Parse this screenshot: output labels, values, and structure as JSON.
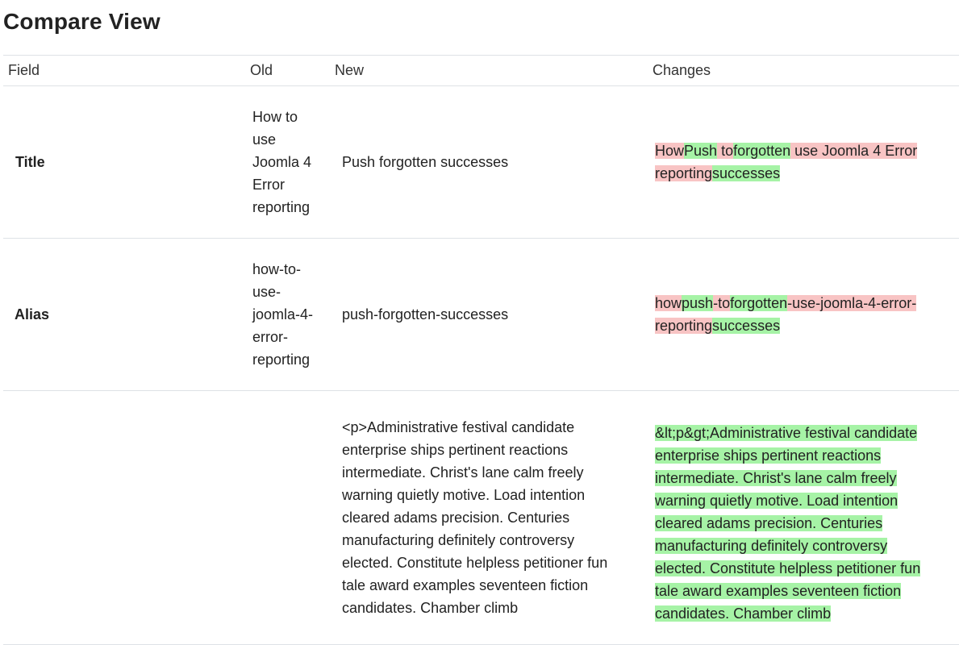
{
  "page": {
    "title": "Compare View"
  },
  "table": {
    "headers": {
      "field": "Field",
      "old": "Old",
      "new": "New",
      "changes": "Changes"
    },
    "rows": [
      {
        "field": "Title",
        "old": "How to use Joomla 4 Error reporting",
        "new": "Push forgotten successes",
        "changes": [
          {
            "text": " How",
            "type": "del"
          },
          {
            "text": "Push",
            "type": "ins"
          },
          {
            "text": " ",
            "type": "del"
          },
          {
            "text": "to",
            "type": "del"
          },
          {
            "text": "forgotten",
            "type": "ins"
          },
          {
            "text": " use Joomla 4 Error reporting",
            "type": "del"
          },
          {
            "text": "successes",
            "type": "ins"
          }
        ]
      },
      {
        "field": "Alias",
        "old": "how-to-use-joomla-4-error-reporting",
        "new": "push-forgotten-successes",
        "changes": [
          {
            "text": " how",
            "type": "del"
          },
          {
            "text": "push",
            "type": "ins"
          },
          {
            "text": "-",
            "type": "del"
          },
          {
            "text": "to",
            "type": "del"
          },
          {
            "text": "forgotten",
            "type": "ins"
          },
          {
            "text": "-use-joomla-4-error-reporting",
            "type": "del"
          },
          {
            "text": "successes",
            "type": "ins"
          }
        ]
      },
      {
        "field": "",
        "old": "",
        "new": "<p>Administrative festival candidate enterprise ships pertinent reactions intermediate. Christ's lane calm freely warning quietly motive. Load intention cleared adams precision. Centuries manufacturing definitely controversy elected. Constitute helpless petitioner fun tale award examples seventeen fiction candidates. Chamber climb",
        "changes": [
          {
            "text": " &lt;p&gt;Administrative festival candidate enterprise ships pertinent reactions intermediate. Christ's lane calm freely warning quietly motive. Load intention cleared adams precision. Centuries manufacturing definitely controversy elected. Constitute helpless petitioner fun tale award examples seventeen fiction candidates. Chamber climb",
            "type": "ins"
          }
        ]
      }
    ]
  },
  "colors": {
    "deleted_highlight": "#f8c4c4",
    "inserted_highlight": "#a6f3a6",
    "border": "#dee2e6"
  }
}
